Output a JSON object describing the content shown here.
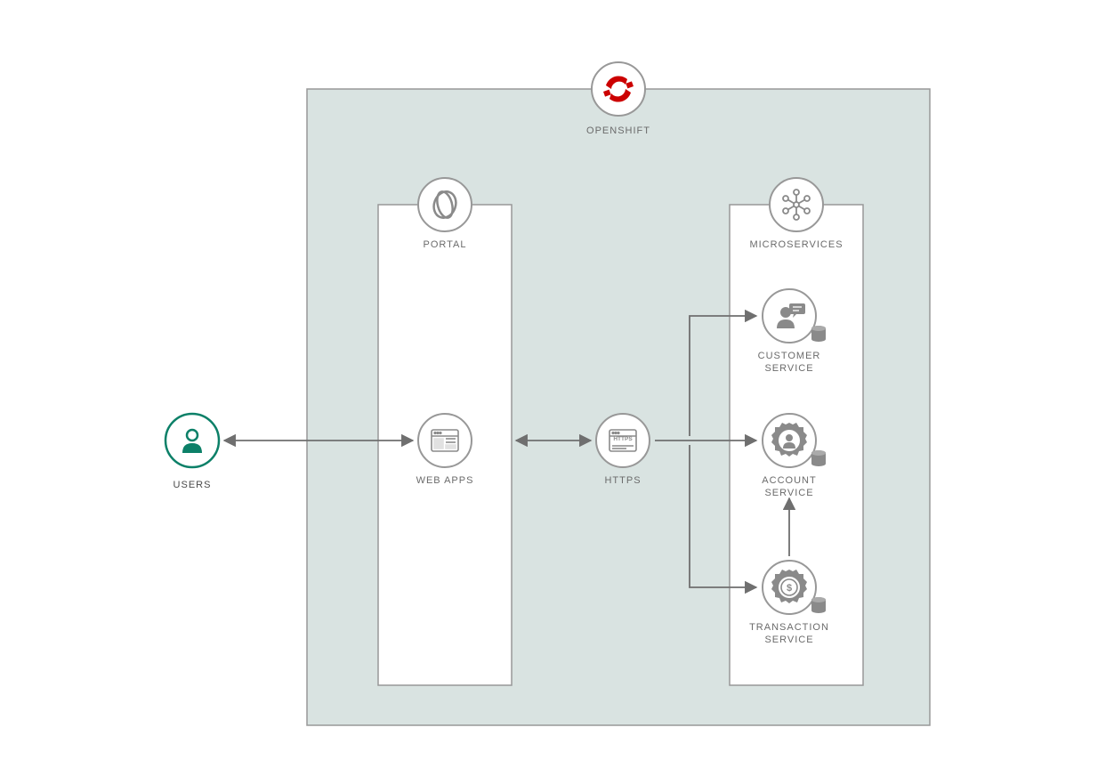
{
  "nodes": {
    "users": "USERS",
    "openshift": "OPENSHIFT",
    "portal": "PORTAL",
    "webapps": "WEB APPS",
    "https": "HTTPS",
    "https_text": "HTTPS",
    "microservices": "MICROSERVICES",
    "customer_service_l1": "CUSTOMER",
    "customer_service_l2": "SERVICE",
    "account_service_l1": "ACCOUNT",
    "account_service_l2": "SERVICE",
    "transaction_service_l1": "TRANSACTION",
    "transaction_service_l2": "SERVICE"
  },
  "colors": {
    "openshift_bg": "#d9e3e1",
    "border": "#989898",
    "stroke": "#6f6f6f",
    "icon": "#8a8a8a",
    "user": "#0c8068",
    "red": "#cc0000"
  }
}
